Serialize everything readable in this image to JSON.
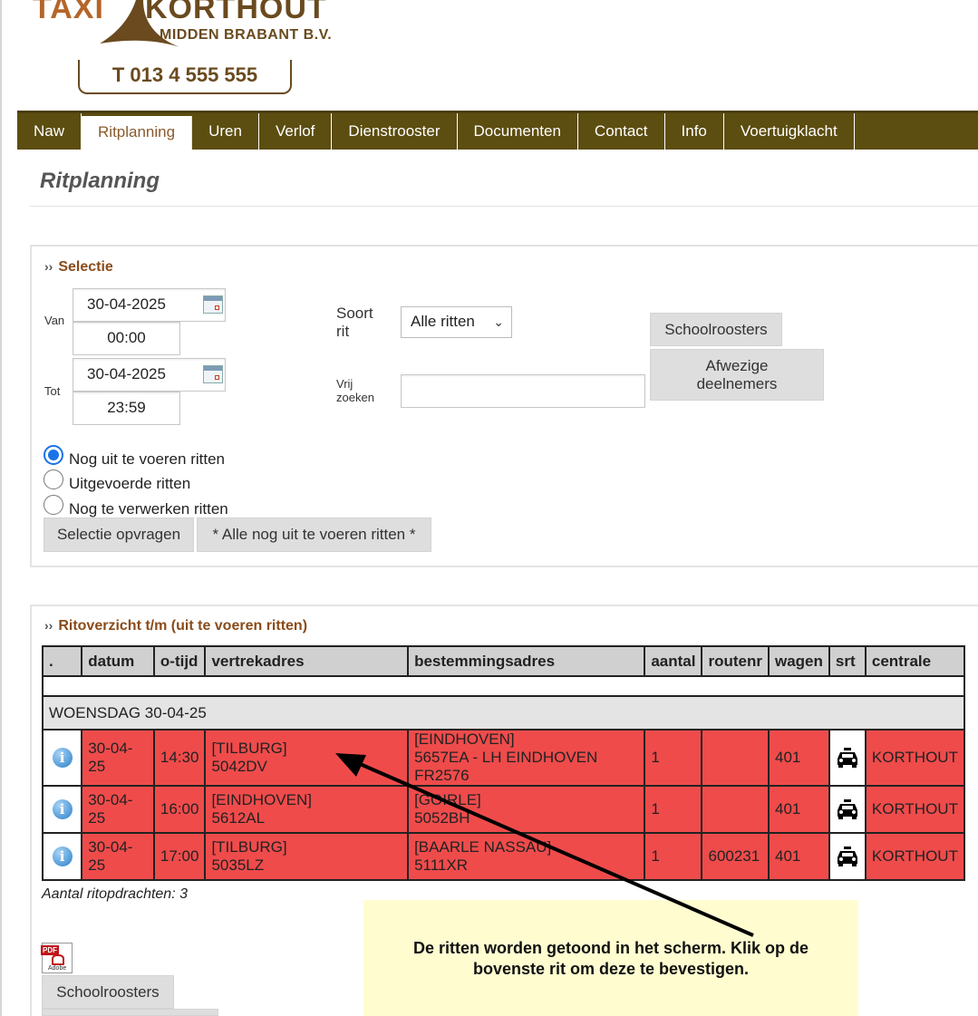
{
  "brand": {
    "name_part1": "TAXI",
    "name_part2": "KORTHOUT",
    "subtitle": "MIDDEN BRABANT B.V.",
    "phone": "T 013 4 555 555",
    "colors": {
      "primary": "#b5652a",
      "dark": "#6a4a1e",
      "nav": "#5c4d10"
    }
  },
  "nav": {
    "items": [
      {
        "label": "Naw"
      },
      {
        "label": "Ritplanning",
        "active": true
      },
      {
        "label": "Uren"
      },
      {
        "label": "Verlof"
      },
      {
        "label": "Dienstrooster"
      },
      {
        "label": "Documenten"
      },
      {
        "label": "Contact"
      },
      {
        "label": "Info"
      },
      {
        "label": "Voertuigklacht"
      }
    ]
  },
  "page": {
    "title": "Ritplanning"
  },
  "selectie": {
    "heading": "Selectie",
    "van_label": "Van",
    "van_date": "30-04-2025",
    "van_time": "00:00",
    "tot_label": "Tot",
    "tot_date": "30-04-2025",
    "tot_time": "23:59",
    "soort_rit_label_1": "Soort",
    "soort_rit_label_2": "rit",
    "soort_rit_value": "Alle ritten",
    "vrij_zoeken_label_1": "Vrij",
    "vrij_zoeken_label_2": "zoeken",
    "vrij_zoeken_value": "",
    "btn_schoolroosters": "Schoolroosters",
    "btn_afwezige_1": "Afwezige",
    "btn_afwezige_2": "deelnemers",
    "radios": [
      {
        "label": "Nog uit te voeren ritten",
        "checked": true
      },
      {
        "label": "Uitgevoerde ritten",
        "checked": false
      },
      {
        "label": "Nog te verwerken ritten",
        "checked": false
      }
    ],
    "btn_opvragen": "Selectie opvragen",
    "btn_alle": "* Alle nog uit te voeren ritten *"
  },
  "overzicht": {
    "heading": "Ritoverzicht t/m (uit te voeren ritten)",
    "columns": [
      ".",
      "datum",
      "o-tijd",
      "vertrekadres",
      "bestemmingsadres",
      "aantal",
      "routenr",
      "wagen",
      "srt",
      "centrale"
    ],
    "day_label": "WOENSDAG 30-04-25",
    "rows": [
      {
        "datum": "30-04-25",
        "tijd": "14:30",
        "vertrek_plaats": "[TILBURG]",
        "vertrek_pc": "5042DV",
        "best_plaats": "[EINDHOVEN]",
        "best_pc": "5657EA - LH EINDHOVEN FR2576",
        "aantal": "1",
        "routenr": "",
        "wagen": "401",
        "srt": "taxi-icon",
        "centrale": "KORTHOUT"
      },
      {
        "datum": "30-04-25",
        "tijd": "16:00",
        "vertrek_plaats": "[EINDHOVEN]",
        "vertrek_pc": "5612AL",
        "best_plaats": "[GOIRLE]",
        "best_pc": "5052BH",
        "aantal": "1",
        "routenr": "",
        "wagen": "401",
        "srt": "taxi-icon",
        "centrale": "KORTHOUT"
      },
      {
        "datum": "30-04-25",
        "tijd": "17:00",
        "vertrek_plaats": "[TILBURG]",
        "vertrek_pc": "5035LZ",
        "best_plaats": "[BAARLE NASSAU]",
        "best_pc": "5111XR",
        "aantal": "1",
        "routenr": "600231",
        "wagen": "401",
        "srt": "taxi-icon",
        "centrale": "KORTHOUT"
      }
    ],
    "count_text": "Aantal ritopdrachten: 3",
    "pdf_icon": "pdf-icon",
    "pdf_tag": "PDF",
    "pdf_sub": "Adobe",
    "btn_schoolroosters": "Schoolroosters"
  },
  "callout": {
    "line1": "De ritten worden getoond in het scherm. Klik op de",
    "line2": "bovenste rit om deze te bevestigen."
  }
}
